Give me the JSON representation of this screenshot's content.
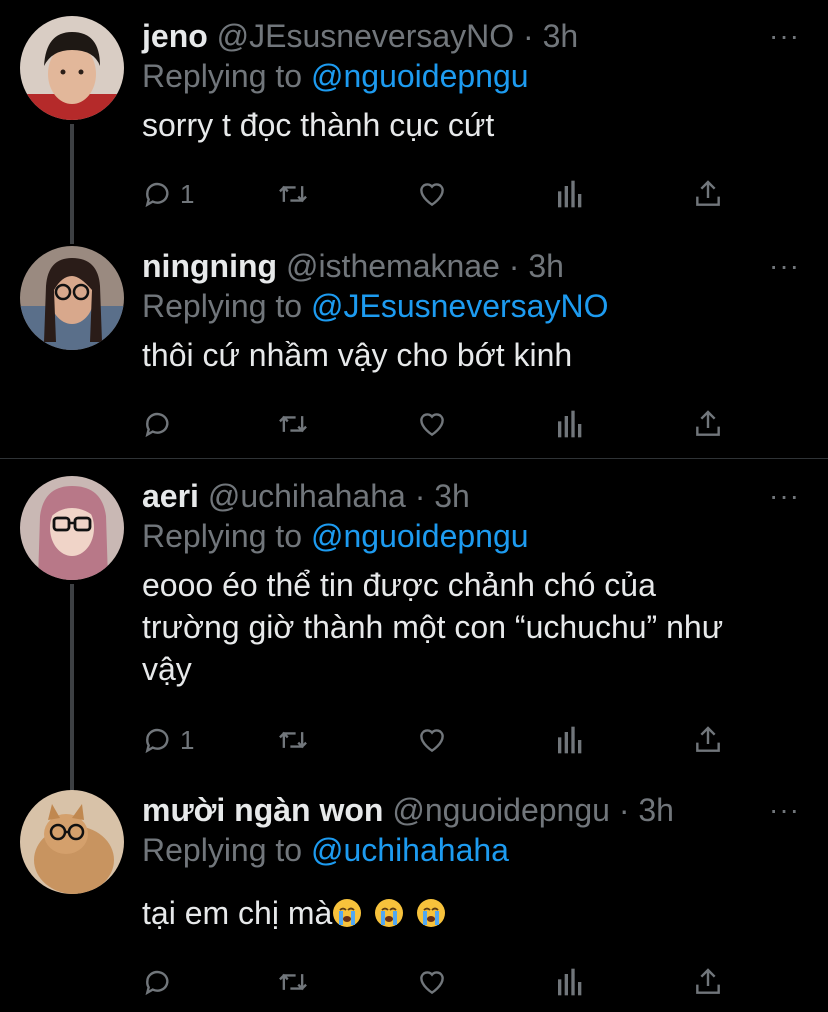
{
  "tweets": [
    {
      "display_name": "jeno",
      "handle": "@JEsusneversayNO",
      "time": "3h",
      "replying_label": "Replying to",
      "replying_to": "@nguoidepngu",
      "text": "sorry t đọc thành cục cứt",
      "reply_count": "1",
      "more": "···"
    },
    {
      "display_name": "ningning",
      "handle": "@isthemaknae",
      "time": "3h",
      "replying_label": "Replying to",
      "replying_to": "@JEsusneversayNO",
      "text": "thôi cứ nhầm vậy cho bớt kinh",
      "reply_count": "",
      "more": "···"
    },
    {
      "display_name": "aeri",
      "handle": "@uchihahaha",
      "time": "3h",
      "replying_label": "Replying to",
      "replying_to": "@nguoidepngu",
      "text": "eooo éo thể tin được chảnh chó của trường giờ thành một con “uchuchu” như vậy",
      "reply_count": "1",
      "more": "···"
    },
    {
      "display_name": "mười ngàn won",
      "handle": "@nguoidepngu",
      "time": "3h",
      "replying_label": "Replying to",
      "replying_to": "@uchihahaha",
      "text": "tại em chị mà",
      "reply_count": "",
      "more": "···"
    }
  ],
  "separator": "·",
  "icons": {
    "reply": "reply-icon",
    "retweet": "retweet-icon",
    "like": "heart-icon",
    "analytics": "analytics-icon",
    "share": "share-icon",
    "emoji": "loudly-crying-face-emoji"
  },
  "colors": {
    "background": "#000000",
    "text": "#e7e9ea",
    "muted": "#71767b",
    "link": "#1d9bf0",
    "thread_line": "#3d4043"
  }
}
